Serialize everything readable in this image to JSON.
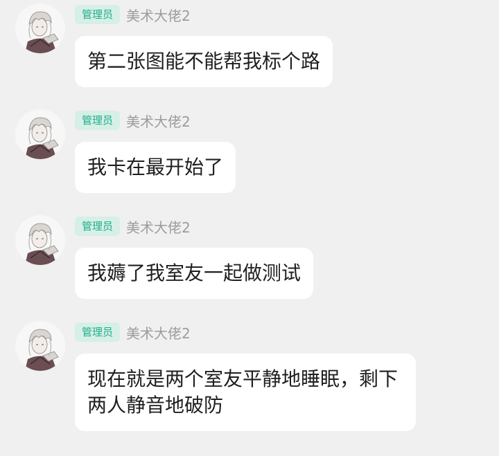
{
  "messages": [
    {
      "role_badge": "管理员",
      "nickname": "美术大佬2",
      "avatar": "anime-character-avatar-icon",
      "text": "第二张图能不能帮我标个路"
    },
    {
      "role_badge": "管理员",
      "nickname": "美术大佬2",
      "avatar": "anime-character-avatar-icon",
      "text": "我卡在最开始了"
    },
    {
      "role_badge": "管理员",
      "nickname": "美术大佬2",
      "avatar": "anime-character-avatar-icon",
      "text": "我薅了我室友一起做测试"
    },
    {
      "role_badge": "管理员",
      "nickname": "美术大佬2",
      "avatar": "anime-character-avatar-icon",
      "text": "现在就是两个室友平静地睡眠，剩下两人静音地破防"
    }
  ],
  "colors": {
    "background": "#f0f0f0",
    "bubble": "#ffffff",
    "badge_bg": "#d6efe7",
    "badge_text": "#1fae8a",
    "nickname": "#9c9c9c",
    "message_text": "#1f1f1f"
  }
}
